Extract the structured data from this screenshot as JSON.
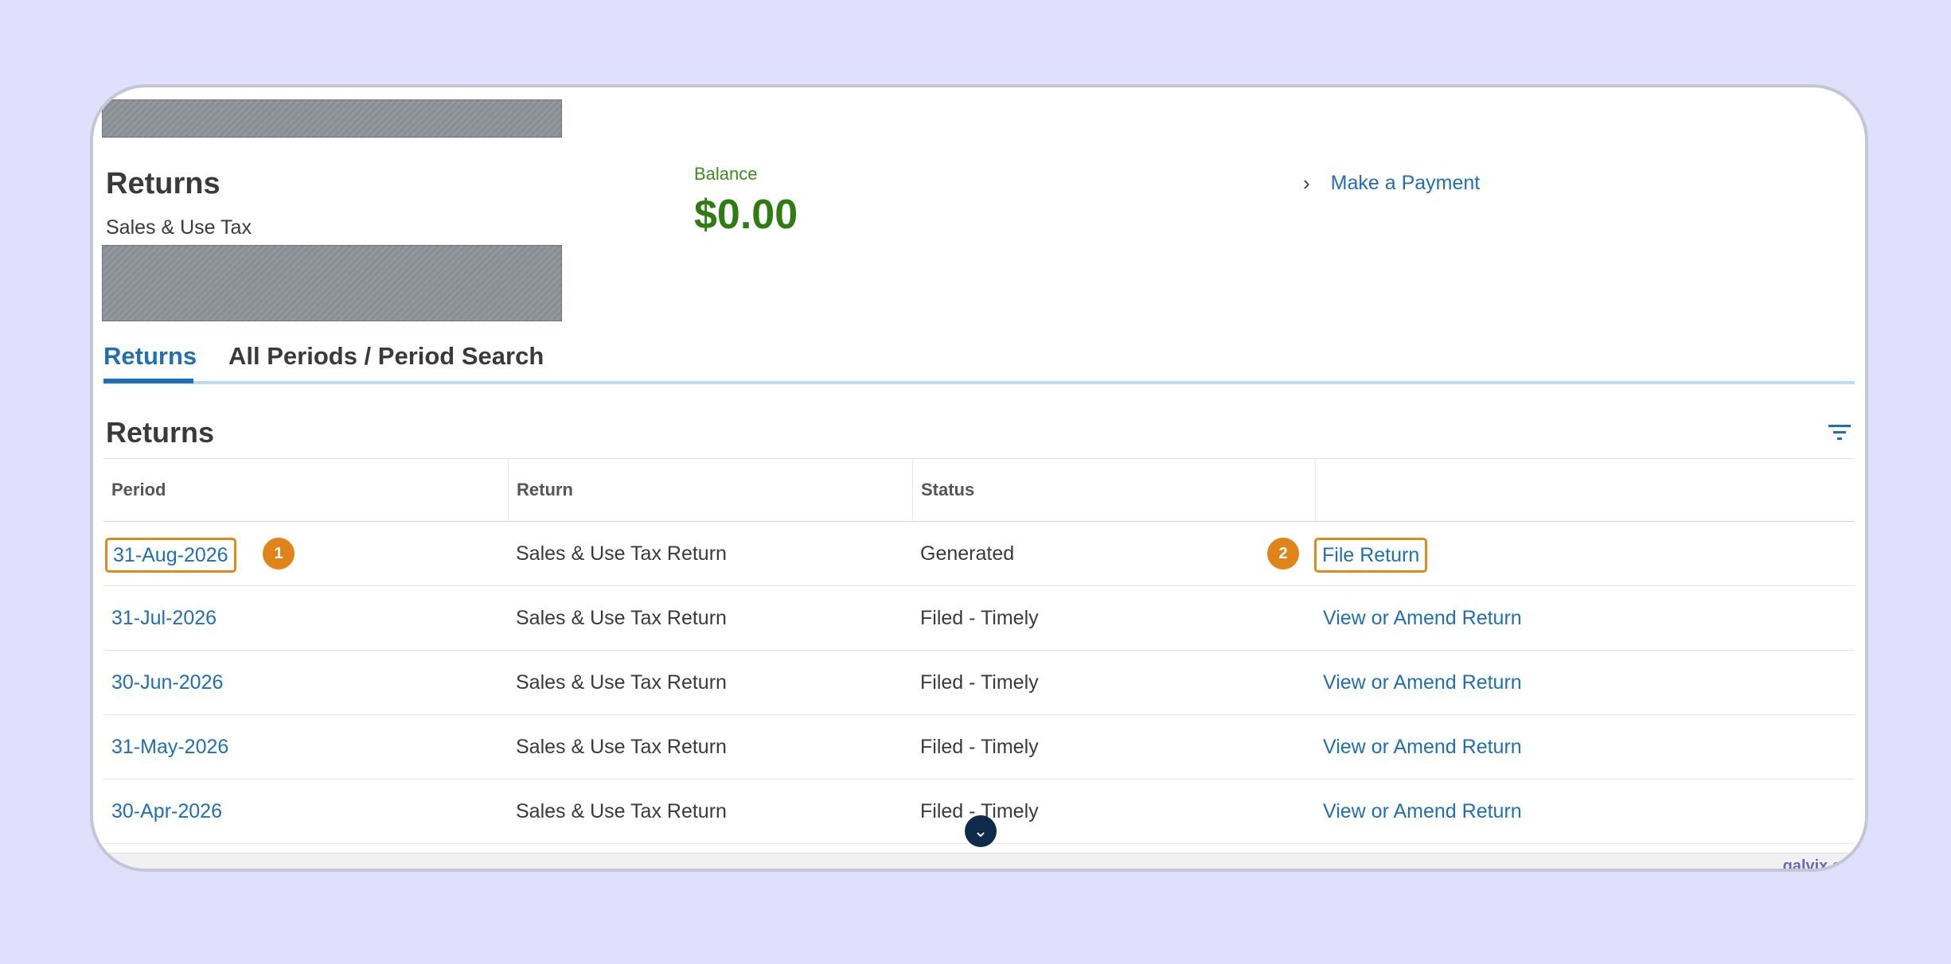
{
  "header": {
    "title": "Returns",
    "subtitle": "Sales & Use Tax",
    "balance_label": "Balance",
    "balance_value": "$0.00",
    "payment_link": "Make a Payment"
  },
  "tabs": [
    {
      "label": "Returns",
      "active": true
    },
    {
      "label": "All Periods / Period Search",
      "active": false
    }
  ],
  "section": {
    "title": "Returns"
  },
  "table": {
    "columns": [
      "Period",
      "Return",
      "Status",
      ""
    ],
    "rows": [
      {
        "period": "31-Aug-2026",
        "return": "Sales & Use Tax Return",
        "status": "Generated",
        "action": "File Return"
      },
      {
        "period": "31-Jul-2026",
        "return": "Sales & Use Tax Return",
        "status": "Filed - Timely",
        "action": "View or Amend Return"
      },
      {
        "period": "30-Jun-2026",
        "return": "Sales & Use Tax Return",
        "status": "Filed - Timely",
        "action": "View or Amend Return"
      },
      {
        "period": "31-May-2026",
        "return": "Sales & Use Tax Return",
        "status": "Filed - Timely",
        "action": "View or Amend Return"
      },
      {
        "period": "30-Apr-2026",
        "return": "Sales & Use Tax Return",
        "status": "Filed - Timely",
        "action": "View or Amend Return"
      }
    ]
  },
  "annotations": {
    "badge_1": "1",
    "badge_2": "2"
  },
  "watermark": "galvix.s",
  "icons": {
    "chevron_right": "chevron-right-icon",
    "filter": "filter-icon",
    "scroll_down": "chevron-down-icon"
  },
  "colors": {
    "link": "#1f6fb2",
    "balance": "#2f7d12",
    "highlight": "#e08a1e",
    "background": "#e0dffc"
  }
}
